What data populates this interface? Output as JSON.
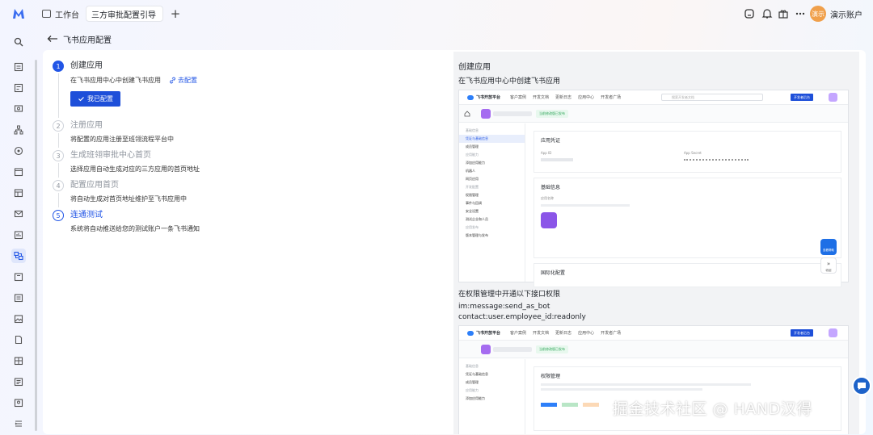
{
  "topbar": {
    "workbench_label": "工作台",
    "active_tab_label": "三方审批配置引导",
    "new_tab_symbol": "+",
    "user_avatar_text": "演示",
    "user_name": "演示账户"
  },
  "page": {
    "title": "飞书应用配置"
  },
  "steps": [
    {
      "num": "1",
      "title": "创建应用",
      "desc": "在飞书应用中心中创建飞书应用",
      "link": "去配置",
      "button": "我已配置"
    },
    {
      "num": "2",
      "title": "注册应用",
      "desc": "将配置的应用注册至班翎流程平台中"
    },
    {
      "num": "3",
      "title": "生成班翎审批中心首页",
      "desc": "选择应用自动生成对应的三方应用的首页地址"
    },
    {
      "num": "4",
      "title": "配置应用首页",
      "desc": "将自动生成对首页地址维护至飞书应用中"
    },
    {
      "num": "5",
      "title": "连通测试",
      "desc": "系统将自动推送给您的测试账户一条飞书通知"
    }
  ],
  "preview": {
    "title": "创建应用",
    "subtitle": "在飞书应用中心中创建飞书应用",
    "perm_note": "在权限管理中开通以下接口权限",
    "scopes": [
      "im:message:send_as_bot",
      "contact:user.employee_id:readonly"
    ],
    "shot": {
      "brand": "飞书开放平台",
      "nav": [
        "客户案例",
        "开发文档",
        "更新日志",
        "应用中心",
        "开发者广场"
      ],
      "search_placeholder": "搜索开发者文档",
      "dev_button": "开发者后台",
      "status_badge": "当前修改版已发布",
      "sidebar": [
        {
          "label": "基础信息",
          "group": true
        },
        {
          "label": "凭证与基础信息",
          "selected": true
        },
        {
          "label": "成员管理"
        },
        {
          "label": "应用能力",
          "group": true
        },
        {
          "label": "添加应用能力"
        },
        {
          "label": "机器人"
        },
        {
          "label": "网页应用"
        },
        {
          "label": "开发配置",
          "group": true
        },
        {
          "label": "权限管理"
        },
        {
          "label": "事件与回调"
        },
        {
          "label": "安全设置"
        },
        {
          "label": "测试企业和人员"
        },
        {
          "label": "应用发布",
          "group": true
        },
        {
          "label": "版本管理与发布"
        }
      ],
      "card1_title": "应用凭证",
      "app_id_label": "App ID",
      "app_secret_label": "App Secret",
      "card2_title": "基础信息",
      "card2_field": "应用名称",
      "card3_title": "国际化配置",
      "float_label_1": "查看帮助",
      "float_label_2": "收起"
    },
    "shot2": {
      "brand": "飞书开放平台",
      "nav": [
        "客户案例",
        "开发文档",
        "更新日志",
        "应用中心",
        "开发者广场"
      ],
      "dev_button": "开发者后台",
      "status_badge": "当前修改版已发布",
      "sidebar": [
        {
          "label": "基础信息",
          "group": true
        },
        {
          "label": "凭证与基础信息"
        },
        {
          "label": "成员管理"
        },
        {
          "label": "应用能力",
          "group": true
        },
        {
          "label": "添加应用能力"
        }
      ],
      "card_title": "权限管理"
    }
  },
  "watermark": "掘金技术社区 @ HAND汉得",
  "colors": {
    "primary": "#2155e6",
    "button": "#1e4fd9",
    "avatar": "#f0a04b"
  }
}
